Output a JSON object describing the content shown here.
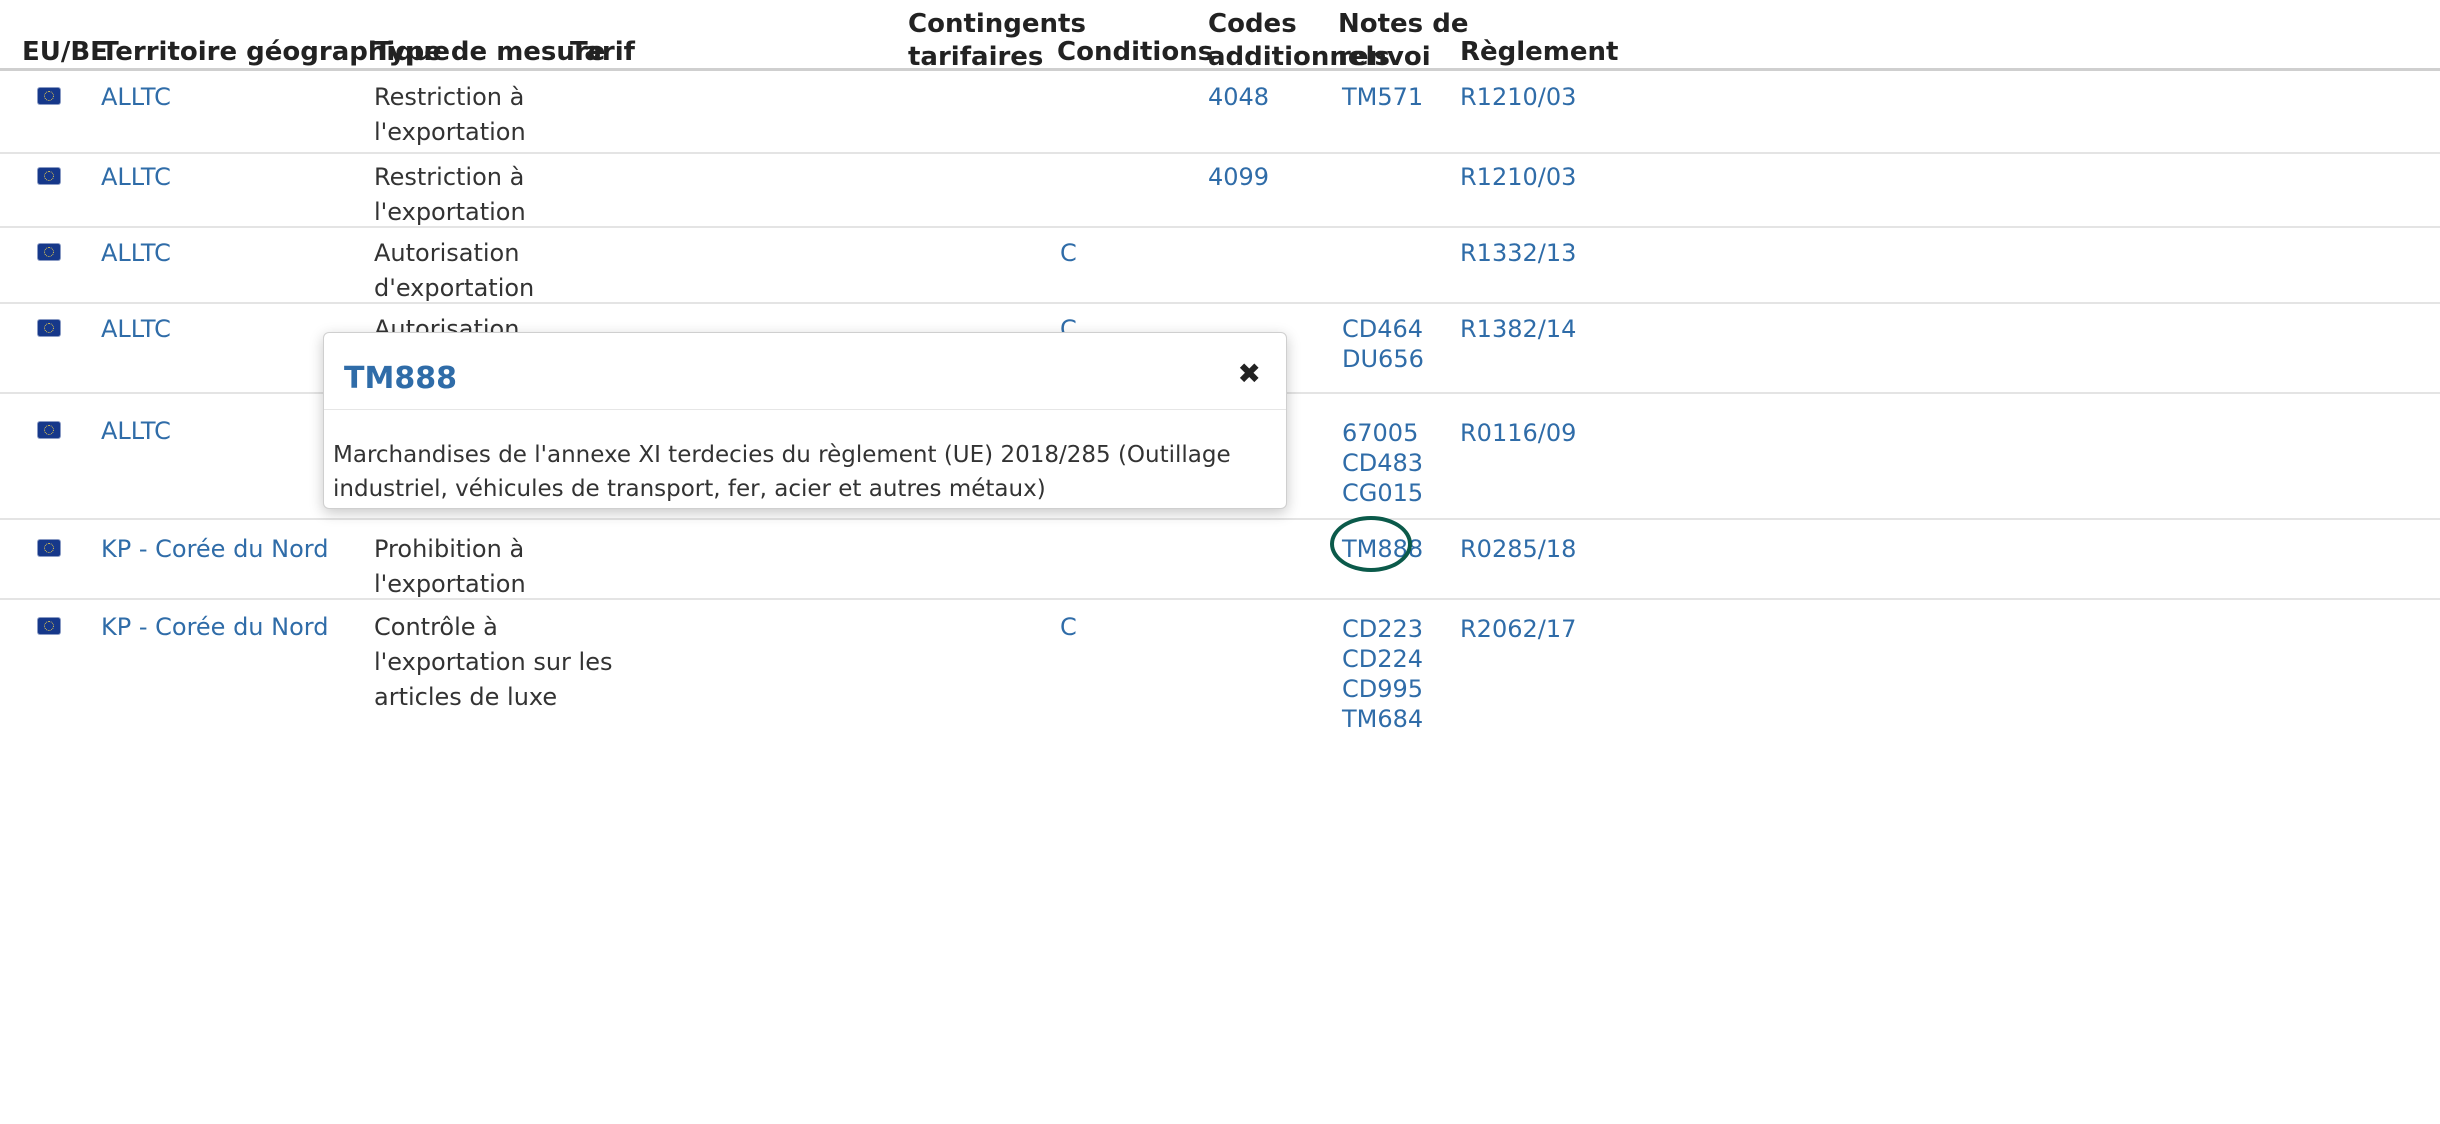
{
  "headers": {
    "eu_be": "EU/BE",
    "territoire": "Territoire géographique",
    "type_mesure": "Type de mesure",
    "tarif": "Tarif",
    "contingents_1": "Contingents",
    "contingents_2": "tarifaires",
    "conditions": "Conditions",
    "codes_1": "Codes",
    "codes_2": "additionnels",
    "notes_1": "Notes de",
    "notes_2": "renvoi",
    "reglement": "Règlement"
  },
  "rows": [
    {
      "flag": "eu-flag-icon",
      "territoire": "ALLTC",
      "type": [
        "Restriction à",
        "l'exportation"
      ],
      "conditions": "",
      "codes": "4048",
      "notes": [
        "TM571"
      ],
      "reglement": "R1210/03"
    },
    {
      "flag": "eu-flag-icon",
      "territoire": "ALLTC",
      "type": [
        "Restriction à",
        "l'exportation"
      ],
      "conditions": "",
      "codes": "4099",
      "notes": [],
      "reglement": "R1210/03"
    },
    {
      "flag": "eu-flag-icon",
      "territoire": "ALLTC",
      "type": [
        "Autorisation",
        "d'exportation"
      ],
      "conditions": "C",
      "codes": "",
      "notes": [],
      "reglement": "R1332/13"
    },
    {
      "flag": "eu-flag-icon",
      "territoire": "ALLTC",
      "type": [
        "Autorisation"
      ],
      "conditions": "C",
      "codes": "",
      "notes": [
        "CD464",
        "DU656"
      ],
      "reglement": "R1382/14"
    },
    {
      "flag": "eu-flag-icon",
      "territoire": "ALLTC",
      "type": [],
      "conditions": "",
      "codes": "",
      "notes": [
        "67005",
        "CD483",
        "CG015"
      ],
      "reglement": "R0116/09"
    },
    {
      "flag": "eu-flag-icon",
      "territoire": "KP - Corée du Nord",
      "type": [
        "Prohibition à",
        "l'exportation"
      ],
      "conditions": "",
      "codes": "",
      "notes": [
        "TM888"
      ],
      "reglement": "R0285/18"
    },
    {
      "flag": "eu-flag-icon",
      "territoire": "KP - Corée du Nord",
      "type": [
        "Contrôle à",
        "l'exportation sur les",
        "articles de luxe"
      ],
      "conditions": "C",
      "codes": "",
      "notes": [
        "CD223",
        "CD224",
        "CD995",
        "TM684"
      ],
      "reglement": "R2062/17"
    }
  ],
  "modal": {
    "title": "TM888",
    "close_icon": "close-icon",
    "body": "Marchandises de l'annexe XI terdecies du règlement (UE) 2018/285 (Outillage industriel, véhicules de transport, fer, acier et autres métaux)"
  },
  "colors": {
    "link": "#2f6ca8",
    "highlight_circle": "#0b5a4a"
  }
}
